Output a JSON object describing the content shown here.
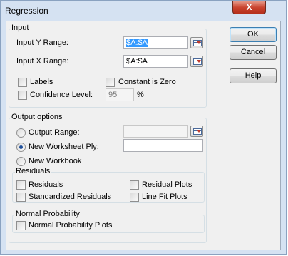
{
  "window": {
    "title": "Regression",
    "close_glyph": "X"
  },
  "input": {
    "group_label": "Input",
    "y_range_label": "Input Y Range:",
    "y_range_value": "$A:$A",
    "x_range_label": "Input X Range:",
    "x_range_value": "$A:$A",
    "labels_label": "Labels",
    "constant_zero_label": "Constant is Zero",
    "confidence_label": "Confidence Level:",
    "confidence_value": "95",
    "percent_sign": "%"
  },
  "output": {
    "group_label": "Output options",
    "output_range_label": "Output Range:",
    "output_range_value": "",
    "new_sheet_label": "New Worksheet Ply:",
    "new_sheet_value": "",
    "new_workbook_label": "New Workbook",
    "selected": "new_sheet"
  },
  "residuals": {
    "group_label": "Residuals",
    "residuals_label": "Residuals",
    "standardized_label": "Standardized Residuals",
    "residual_plots_label": "Residual Plots",
    "line_fit_label": "Line Fit Plots"
  },
  "normal_probability": {
    "group_label": "Normal Probability",
    "plots_label": "Normal Probability Plots"
  },
  "buttons": {
    "ok": "OK",
    "cancel": "Cancel",
    "help": "Help"
  }
}
